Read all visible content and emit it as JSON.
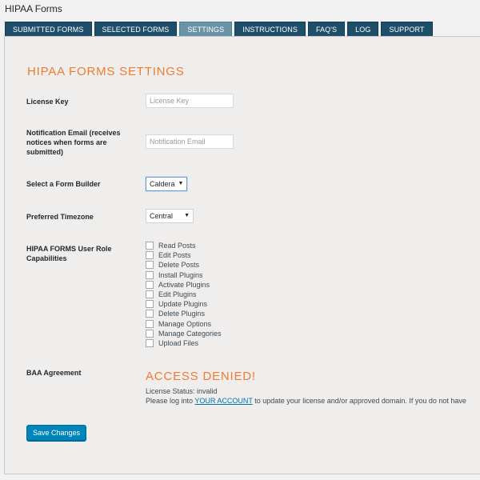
{
  "page": {
    "title": "HIPAA Forms"
  },
  "tabs": [
    {
      "label": "SUBMITTED FORMS"
    },
    {
      "label": "SELECTED FORMS"
    },
    {
      "label": "SETTINGS",
      "active": true
    },
    {
      "label": "INSTRUCTIONS"
    },
    {
      "label": "FAQ'S"
    },
    {
      "label": "LOG"
    },
    {
      "label": "SUPPORT"
    }
  ],
  "settings": {
    "section_title": "HIPAA FORMS SETTINGS",
    "license_key": {
      "label": "License Key",
      "placeholder": "License Key",
      "value": ""
    },
    "notification_email": {
      "label": "Notification Email (receives notices when forms are submitted)",
      "placeholder": "Notification Email",
      "value": ""
    },
    "form_builder": {
      "label": "Select a Form Builder",
      "selected": "Caldera"
    },
    "timezone": {
      "label": "Preferred Timezone",
      "selected": "Central"
    },
    "capabilities": {
      "label": "HIPAA FORMS User Role Capabilities",
      "items": [
        {
          "label": "Read Posts",
          "checked": false
        },
        {
          "label": "Edit Posts",
          "checked": false
        },
        {
          "label": "Delete Posts",
          "checked": false
        },
        {
          "label": "Install Plugins",
          "checked": false
        },
        {
          "label": "Activate Plugins",
          "checked": false
        },
        {
          "label": "Edit Plugins",
          "checked": false
        },
        {
          "label": "Update Plugins",
          "checked": false
        },
        {
          "label": "Delete Plugins",
          "checked": false
        },
        {
          "label": "Manage Options",
          "checked": false
        },
        {
          "label": "Manage Categories",
          "checked": false
        },
        {
          "label": "Upload Files",
          "checked": false
        }
      ]
    },
    "baa": {
      "label": "BAA Agreement",
      "denied_title": "ACCESS DENIED!",
      "status_text": "License Status: invalid",
      "account_prefix": "Please log into ",
      "account_link": "YOUR ACCOUNT",
      "account_suffix": " to update your license and/or approved domain. If you do not have"
    },
    "save_label": "Save Changes"
  },
  "colors": {
    "tab_bg": "#1f4e6b",
    "tab_active_bg": "#6a93a8",
    "accent_orange": "#ef7c31",
    "button_blue": "#0085ba",
    "link_blue": "#0073aa"
  }
}
